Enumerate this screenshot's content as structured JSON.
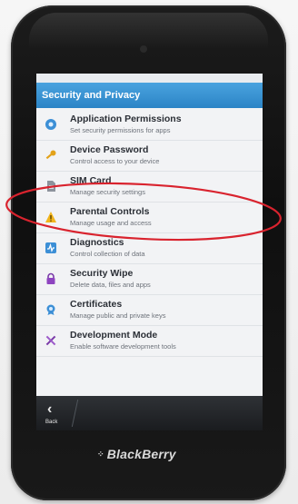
{
  "screen": {
    "title": "Security and Privacy",
    "items": [
      {
        "title": "Application Permissions",
        "subtitle": "Set security permissions for apps",
        "icon": "app-permissions-icon"
      },
      {
        "title": "Device Password",
        "subtitle": "Control access to your device",
        "icon": "key-icon"
      },
      {
        "title": "SIM Card",
        "subtitle": "Manage security settings",
        "icon": "sim-card-icon"
      },
      {
        "title": "Parental Controls",
        "subtitle": "Manage usage and access",
        "icon": "warning-triangle-icon"
      },
      {
        "title": "Diagnostics",
        "subtitle": "Control collection of data",
        "icon": "diagnostics-icon"
      },
      {
        "title": "Security Wipe",
        "subtitle": "Delete data, files and apps",
        "icon": "lock-icon"
      },
      {
        "title": "Certificates",
        "subtitle": "Manage public and private keys",
        "icon": "certificate-icon"
      },
      {
        "title": "Development Mode",
        "subtitle": "Enable software development tools",
        "icon": "tools-icon"
      }
    ],
    "back_label": "Back"
  },
  "device": {
    "brand": "BlackBerry"
  },
  "colors": {
    "title_bar": "#2b84c6",
    "annotation": "#d9232e"
  }
}
